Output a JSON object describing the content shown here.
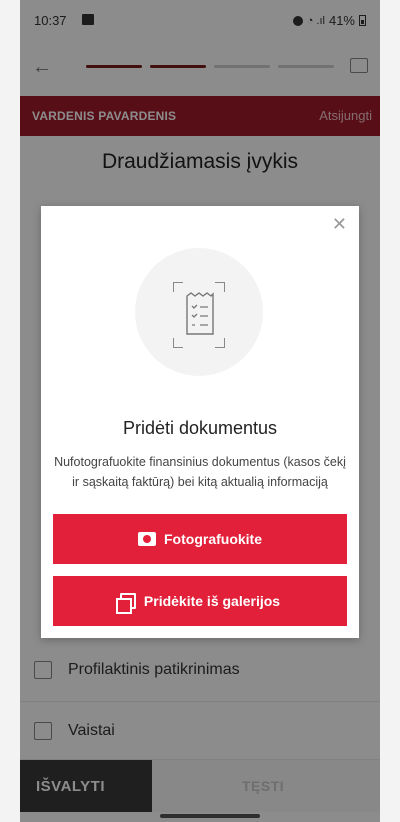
{
  "status": {
    "time": "10:37",
    "battery": "41%"
  },
  "header": {
    "user_name": "VARDENIS PAVARDENIS",
    "logout_label": "Atsijungti"
  },
  "page": {
    "title": "Draudžiamasis įvykis"
  },
  "list": {
    "items": [
      "Profilaktinis patikrinimas",
      "Vaistai"
    ]
  },
  "footer": {
    "clear_label": "IŠVALYTI",
    "continue_label": "TĘSTI"
  },
  "modal": {
    "title": "Pridėti dokumentus",
    "description": "Nufotografuokite finansinius dokumentus (kasos čekį ir sąskaitą faktūrą) bei kitą aktualią informaciją",
    "photo_button": "Fotografuokite",
    "gallery_button": "Pridėkite iš galerijos"
  },
  "progress": {
    "current_step": 2,
    "total_steps": 4
  },
  "colors": {
    "brand": "#a01b2b",
    "action": "#e3203a",
    "progress_active": "#7b1a1a"
  }
}
